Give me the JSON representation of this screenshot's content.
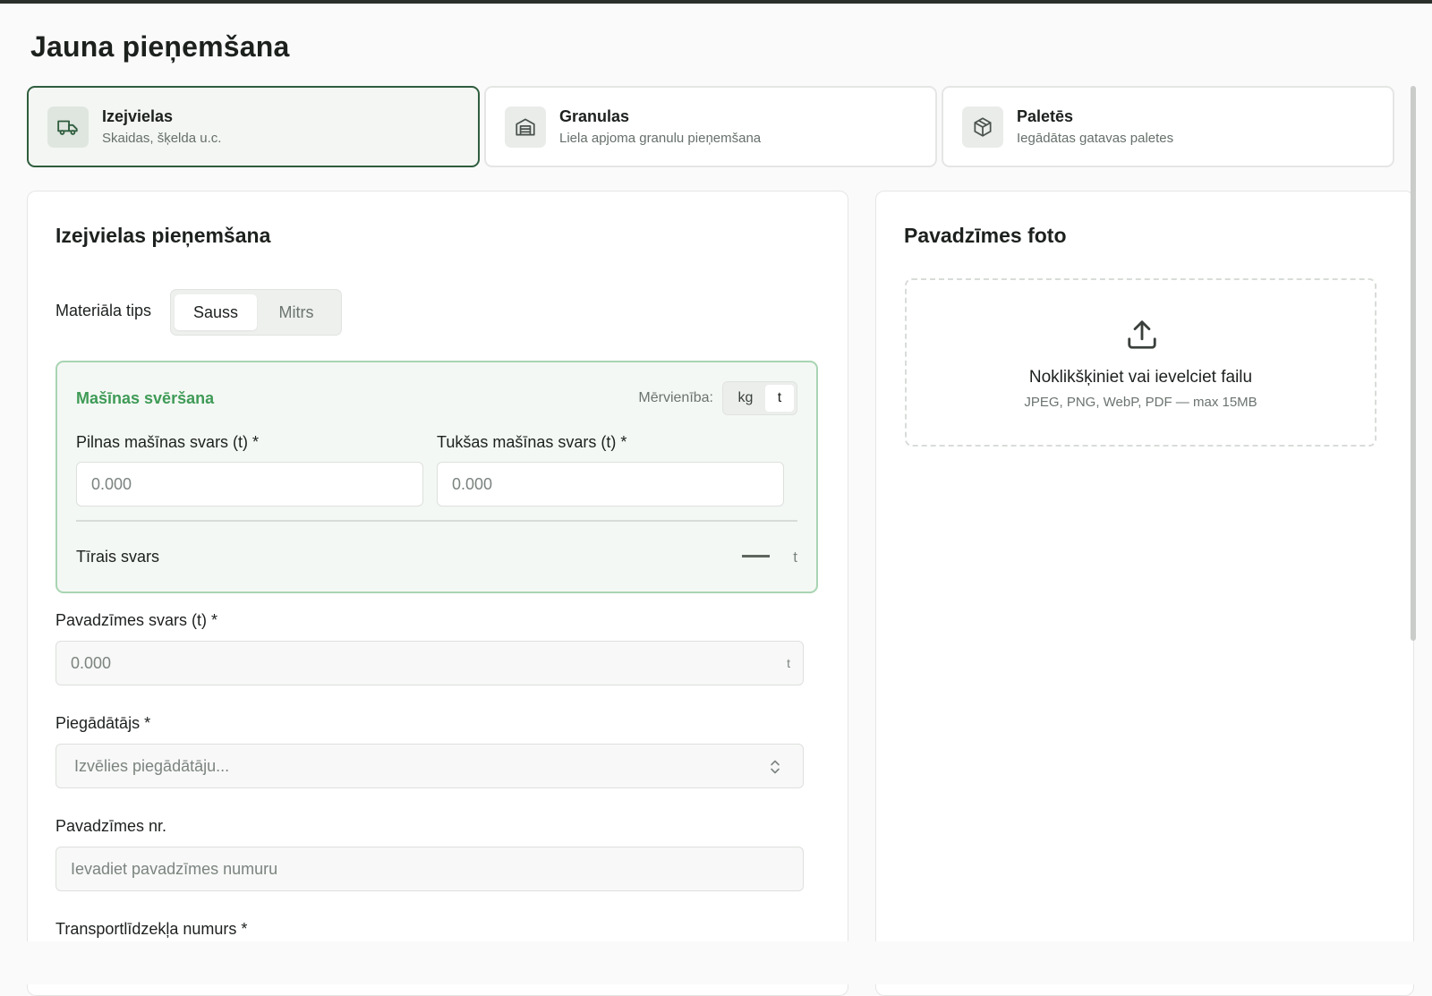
{
  "page": {
    "title": "Jauna pieņemšana"
  },
  "types": [
    {
      "name": "Izejvielas",
      "desc": "Skaidas, šķelda u.c.",
      "icon": "truck-icon",
      "active": true
    },
    {
      "name": "Granulas",
      "desc": "Liela apjoma granulu pieņemšana",
      "icon": "warehouse-icon",
      "active": false
    },
    {
      "name": "Paletēs",
      "desc": "Iegādātas gatavas paletes",
      "icon": "package-icon",
      "active": false
    }
  ],
  "form": {
    "title": "Izejvielas pieņemšana",
    "material": {
      "label": "Materiāla tips",
      "options": [
        "Sauss",
        "Mitrs"
      ],
      "selected": "Sauss"
    },
    "weighing": {
      "title": "Mašīnas svēršana",
      "unit_label": "Mērvienība:",
      "units": [
        "kg",
        "t"
      ],
      "selected_unit": "t",
      "full_label": "Pilnas mašīnas svars (t) *",
      "full_placeholder": "0.000",
      "empty_label": "Tukšas mašīnas svars (t) *",
      "empty_placeholder": "0.000",
      "net_label": "Tīrais svars",
      "net_unit": "t"
    },
    "invoice_weight": {
      "label": "Pavadzīmes svars (t) *",
      "placeholder": "0.000",
      "suffix": "t"
    },
    "supplier": {
      "label": "Piegādātājs *",
      "placeholder": "Izvēlies piegādātāju..."
    },
    "invoice_no": {
      "label": "Pavadzīmes nr.",
      "placeholder": "Ievadiet pavadzīmes numuru"
    },
    "vehicle": {
      "label": "Transportlīdzekļa numurs *"
    }
  },
  "photo": {
    "title": "Pavadzīmes foto",
    "drop_text": "Noklikšķiniet vai ievelciet failu",
    "drop_hint": "JPEG, PNG, WebP, PDF — max 15MB",
    "icon": "upload-icon"
  },
  "colors": {
    "accent": "#2f5d3e",
    "green_title": "#3f9b57",
    "green_border": "#a8d4b2"
  }
}
